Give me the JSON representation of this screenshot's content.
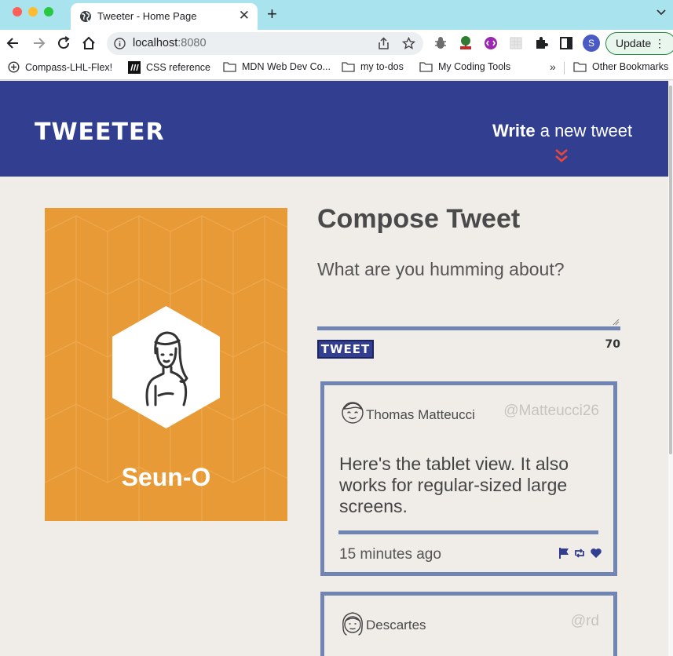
{
  "browser": {
    "tab_title": "Tweeter - Home Page",
    "url_host": "localhost",
    "url_port": ":8080",
    "update_label": "Update",
    "profile_initial": "S",
    "bookmarks": [
      {
        "label": "Compass-LHL-Flex!",
        "icon": "plus-circle-icon"
      },
      {
        "label": "CSS reference",
        "icon": "mdn-icon"
      },
      {
        "label": "MDN Web Dev Co...",
        "icon": "folder-icon"
      },
      {
        "label": "my to-dos",
        "icon": "folder-icon"
      },
      {
        "label": "My Coding Tools",
        "icon": "folder-icon"
      },
      {
        "label": "Other Bookmarks",
        "icon": "folder-icon"
      }
    ],
    "bookmarks_overflow": "»"
  },
  "nav": {
    "brand": "TWEETER",
    "write_bold": "Write",
    "write_rest": " a new tweet"
  },
  "profile": {
    "name": "Seun-O"
  },
  "compose": {
    "title": "Compose Tweet",
    "placeholder": "What are you humming about?",
    "button_label": "TWEET",
    "counter": "70"
  },
  "tweets": [
    {
      "name": "Thomas Matteucci",
      "handle": "@Matteucci26",
      "content": "Here's the tablet view. It also works for regular-sized large screens.",
      "time": "15 minutes ago"
    },
    {
      "name": "Descartes",
      "handle": "@rd"
    }
  ],
  "colors": {
    "nav_bg": "#323f90",
    "card_bg": "#e89a36",
    "page_bg": "#f0ede8",
    "border": "#7185b3",
    "chevron": "#e8463a"
  }
}
